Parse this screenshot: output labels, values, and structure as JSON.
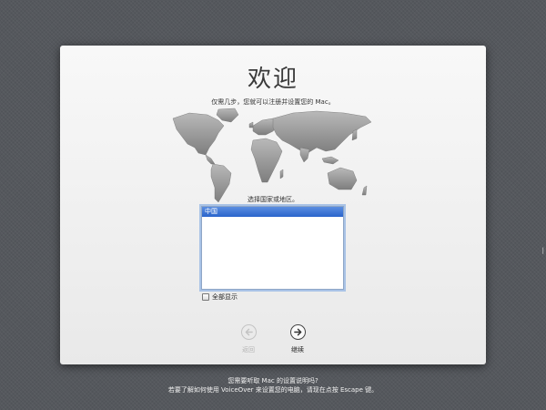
{
  "setup": {
    "title": "欢迎",
    "subtitle": "仅需几步，您就可以注册并设置您的 Mac。",
    "region_prompt": "选择国家或地区。",
    "regions": [
      {
        "label": "中国",
        "selected": true
      }
    ],
    "show_all_label": "全部显示",
    "show_all_checked": false,
    "back_label": "返回",
    "back_icon": "arrow-left-icon",
    "continue_label": "继续",
    "continue_icon": "arrow-right-icon",
    "accent_color": "#3a72d4"
  },
  "footer": {
    "line1": "您需要听取 Mac 的设置说明吗?",
    "line2": "若要了解如何使用 VoiceOver 来设置您的电脑，请现在点按 Escape 键。"
  },
  "edge_mark": "|"
}
